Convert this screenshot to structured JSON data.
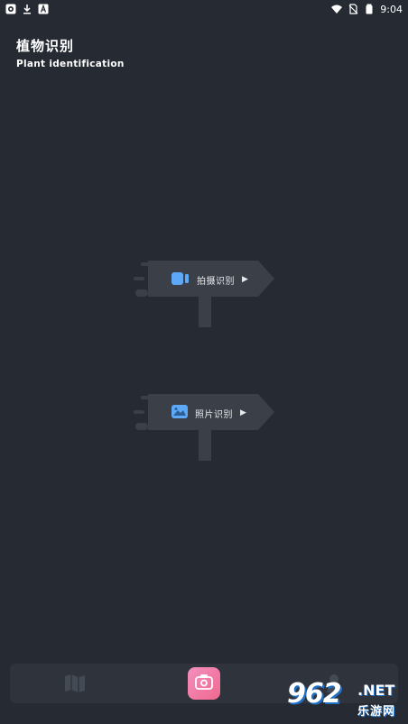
{
  "status_bar": {
    "time": "9:04",
    "left_icons": [
      "app-notification-icon",
      "download-icon",
      "a-box-icon"
    ],
    "right_icons": [
      "wifi-icon",
      "no-sim-icon",
      "battery-icon"
    ]
  },
  "header": {
    "title_cn": "植物识别",
    "title_en": "Plant identification"
  },
  "signs": [
    {
      "label": "拍摄识别",
      "icon": "video-camera-icon",
      "icon_color": "#5ea9f7"
    },
    {
      "label": "照片识别",
      "icon": "image-icon",
      "icon_color": "#5ea9f7"
    }
  ],
  "bottom_nav": {
    "items": [
      "map-icon",
      "camera-icon",
      "person-icon"
    ],
    "camera_gradient": [
      "#f38fbf",
      "#f0698e"
    ]
  },
  "watermark": {
    "number": "962",
    "net": ".NET",
    "cn": "乐游网"
  },
  "colors": {
    "background": "#262b33",
    "sign": "#3a3f48",
    "nav": "#2f343c"
  }
}
